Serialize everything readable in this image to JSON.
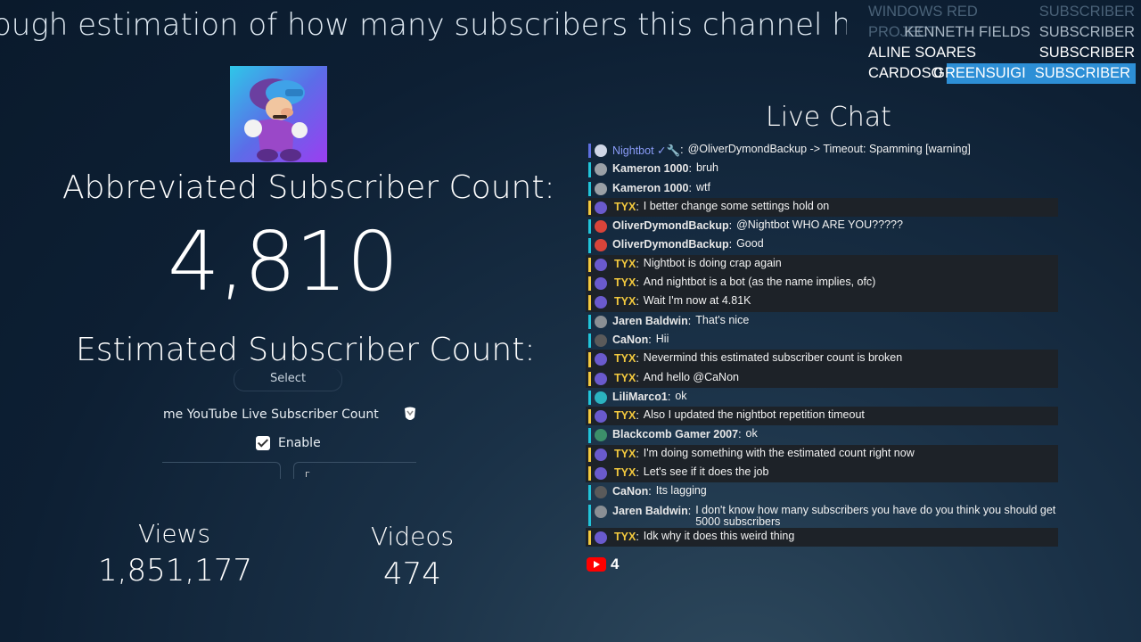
{
  "ticker": {
    "text": "ough estimation of how many subscribers this channel has. I"
  },
  "recent_subscribers": [
    {
      "name": "WINDOWS RED PROJECT",
      "tag": "SUBSCRIBER"
    },
    {
      "name": "KENNETH FIELDS",
      "tag": "SUBSCRIBER"
    },
    {
      "name": "ALINE SOARES CARDOSO",
      "tag": "SUBSCRIBER"
    },
    {
      "name": "GREENSUIGI",
      "tag": "SUBSCRIBER"
    }
  ],
  "left": {
    "abbreviated_label": "Abbreviated Subscriber Count:",
    "abbreviated_count": "4,810",
    "estimated_label": "Estimated Subscriber Count:",
    "select_label": "Select",
    "widget_title": "me YouTube Live Subscriber Count",
    "enable_label": "Enable",
    "input_b_text": "г",
    "views_label": "Views",
    "views_value": "1,851,177",
    "videos_label": "Videos",
    "videos_value": "474"
  },
  "chat": {
    "title": "Live Chat",
    "messages": [
      {
        "name": "Nightbot ✓🔧",
        "text": "@OliverDymondBackup -> Timeout: Spamming [warning]",
        "role": "mod",
        "avatar": "#cfd6e6"
      },
      {
        "name": "Kameron 1000",
        "text": "bruh",
        "role": "member",
        "avatar": "#9aa0a6"
      },
      {
        "name": "Kameron 1000",
        "text": "wtf",
        "role": "member",
        "avatar": "#9aa0a6"
      },
      {
        "name": "TYX",
        "text": "I better change some settings hold on",
        "role": "owner",
        "avatar": "#6a5acd"
      },
      {
        "name": "OliverDymondBackup",
        "text": "@Nightbot WHO ARE YOU?????",
        "role": "member",
        "avatar": "#d9443a"
      },
      {
        "name": "OliverDymondBackup",
        "text": "Good",
        "role": "member",
        "avatar": "#d9443a"
      },
      {
        "name": "TYX",
        "text": "Nightbot is doing crap again",
        "role": "owner",
        "avatar": "#6a5acd"
      },
      {
        "name": "TYX",
        "text": "And nightbot is a bot (as the name implies, ofc)",
        "role": "owner",
        "avatar": "#6a5acd"
      },
      {
        "name": "TYX",
        "text": "Wait I'm now at 4.81K",
        "role": "owner",
        "avatar": "#6a5acd"
      },
      {
        "name": "Jaren Baldwin",
        "text": "That's nice",
        "role": "member",
        "avatar": "#8a8f94"
      },
      {
        "name": "CaNon",
        "text": "Hii",
        "role": "member",
        "avatar": "#5a5a5a"
      },
      {
        "name": "TYX",
        "text": "Nevermind this estimated subscriber count is broken",
        "role": "owner",
        "avatar": "#6a5acd"
      },
      {
        "name": "TYX",
        "text": "And hello @CaNon",
        "role": "owner",
        "avatar": "#6a5acd"
      },
      {
        "name": "LiliMarco1",
        "text": "ok",
        "role": "member",
        "avatar": "#2bb3c0"
      },
      {
        "name": "TYX",
        "text": "Also I updated the nightbot repetition timeout",
        "role": "owner",
        "avatar": "#6a5acd"
      },
      {
        "name": "Blackcomb Gamer 2007",
        "text": "ok",
        "role": "member",
        "avatar": "#3c8f6a"
      },
      {
        "name": "TYX",
        "text": "I'm doing something with the estimated count right now",
        "role": "owner",
        "avatar": "#6a5acd"
      },
      {
        "name": "TYX",
        "text": "Let's see if it does the job",
        "role": "owner",
        "avatar": "#6a5acd"
      },
      {
        "name": "CaNon",
        "text": "Its lagging",
        "role": "member",
        "avatar": "#5a5a5a"
      },
      {
        "name": "Jaren Baldwin",
        "text": "I don't know how many subscribers you have do you think you should get 5000 subscribers",
        "role": "member",
        "avatar": "#8a8f94"
      },
      {
        "name": "TYX",
        "text": "Idk why it does this weird thing",
        "role": "owner",
        "avatar": "#6a5acd"
      }
    ],
    "viewer_count": "4"
  },
  "colors": {
    "accent": "#2d8fd6",
    "owner": "#f3c93e",
    "member_bar": "#21c4d9",
    "youtube_red": "#ff0000"
  }
}
